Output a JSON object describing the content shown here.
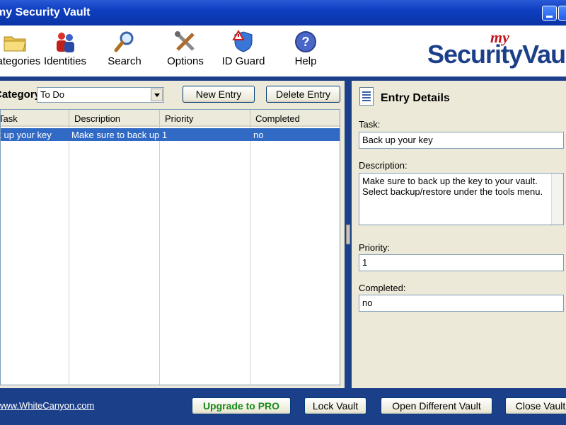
{
  "window": {
    "title": "my Security Vault"
  },
  "toolbar": {
    "items": [
      {
        "label": "Categories",
        "icon": "folder-icon"
      },
      {
        "label": "Identities",
        "icon": "people-icon"
      },
      {
        "label": "Search",
        "icon": "magnifier-icon"
      },
      {
        "label": "Options",
        "icon": "tools-icon"
      },
      {
        "label": "ID Guard",
        "icon": "shield-warning-icon"
      },
      {
        "label": "Help",
        "icon": "help-icon"
      }
    ],
    "logo": {
      "my": "my",
      "name": "SecurityVault"
    }
  },
  "left": {
    "category_label": "Category:",
    "category_value": "To Do",
    "new_entry": "New Entry",
    "delete_entry": "Delete Entry",
    "columns": [
      "Task",
      "Description",
      "Priority",
      "Completed"
    ],
    "rows": [
      {
        "task": "Back up your key",
        "description": "Make sure to back up the key to your vault.",
        "priority": "1",
        "completed": "no"
      }
    ]
  },
  "details": {
    "title": "Entry Details",
    "task_label": "Task:",
    "task_value": "Back up your key",
    "description_label": "Description:",
    "description_value": "Make sure to back up the key to your vault.  Select backup/restore under the tools menu.",
    "priority_label": "Priority:",
    "priority_value": "1",
    "completed_label": "Completed:",
    "completed_value": "no"
  },
  "bottom": {
    "link": "www.WhiteCanyon.com",
    "upgrade": "Upgrade to PRO",
    "lock": "Lock Vault",
    "open_different": "Open Different Vault",
    "close": "Close Vault"
  },
  "colors": {
    "frame": "#1c3f8a",
    "selection": "#316ac5",
    "upgrade_text": "#1a8a1a"
  }
}
